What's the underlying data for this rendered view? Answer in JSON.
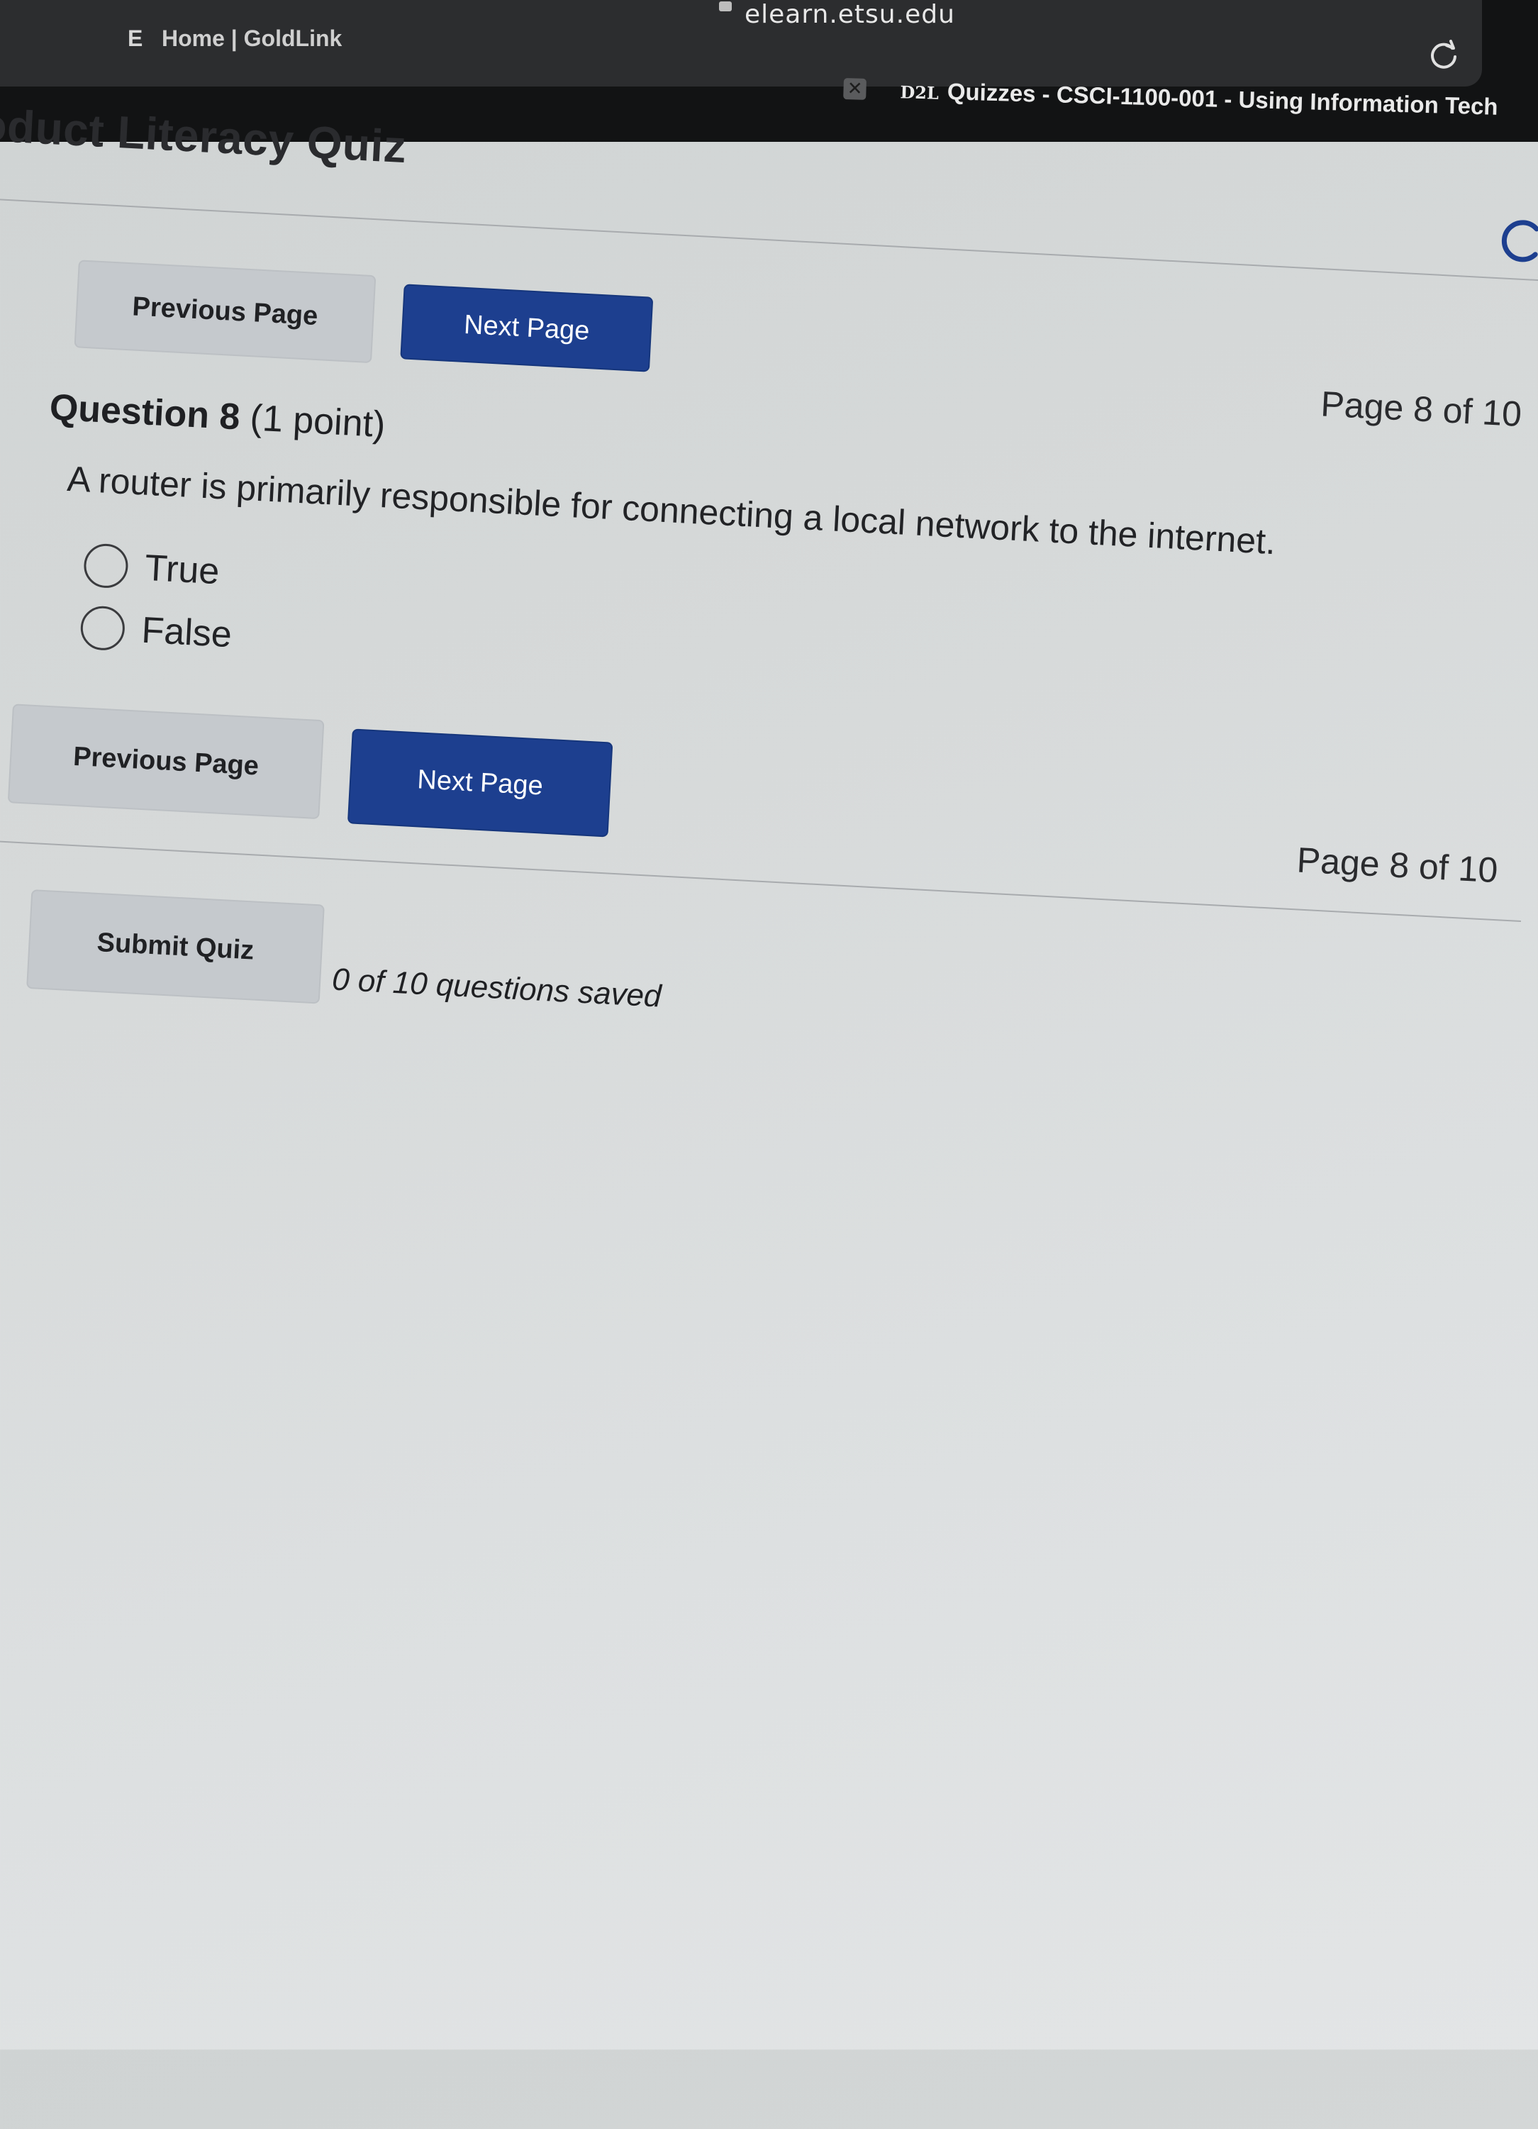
{
  "browser": {
    "url": "elearn.etsu.edu",
    "tab_left": {
      "favicon_letter": "E",
      "title": "Home | GoldLink"
    },
    "tab_right": {
      "close_glyph": "✕",
      "favicon": "D2L",
      "title": "Quizzes - CSCI-1100-001 - Using Information Tech"
    }
  },
  "quiz": {
    "title": "oduct Literacy Quiz",
    "nav_top": {
      "previous_label": "Previous Page",
      "next_label": "Next Page",
      "page_indicator": "Page 8 of 10"
    },
    "question": {
      "number_label": "Question 8",
      "points_label": "(1 point)",
      "text": "A router is primarily responsible for connecting a local network to the internet.",
      "options": [
        "True",
        "False"
      ]
    },
    "nav_bottom": {
      "previous_label": "Previous Page",
      "next_label": "Next Page",
      "page_indicator": "Page 8 of 10"
    },
    "submit_label": "Submit Quiz",
    "saved_status": "0 of 10 questions saved"
  },
  "colors": {
    "primary_button": "#1d3f8f",
    "secondary_button": "#c5c9cd"
  }
}
